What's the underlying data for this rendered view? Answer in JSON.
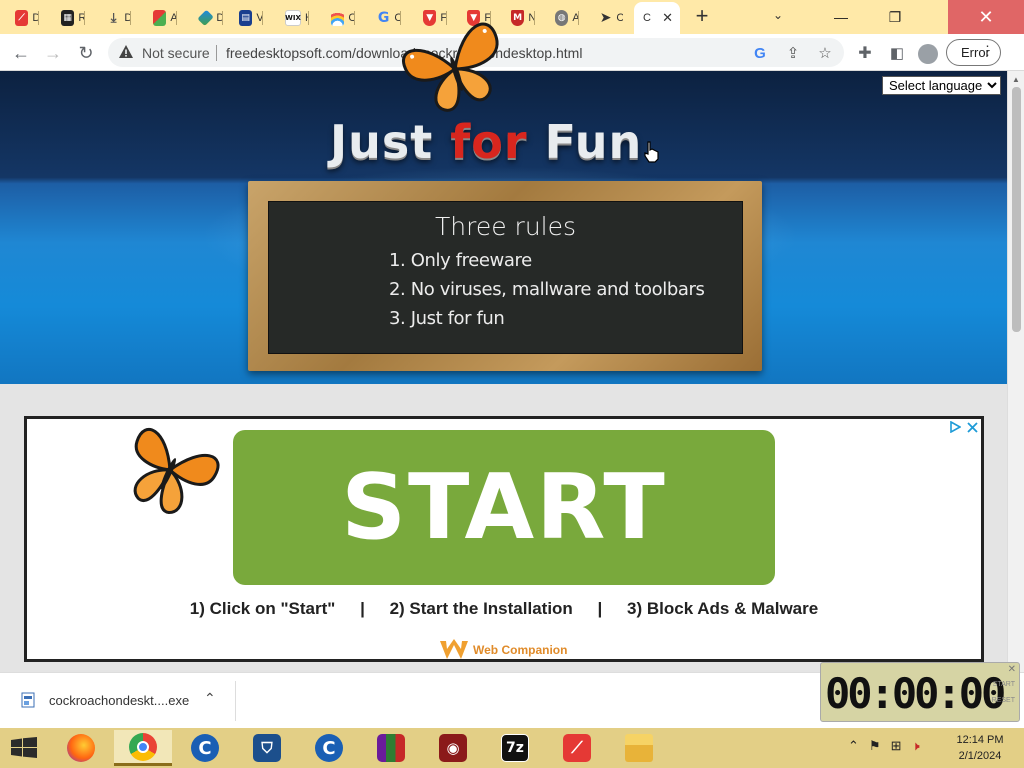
{
  "browser": {
    "tabs": [
      {
        "title": "D",
        "icon": "avira-icon",
        "color": "#e53935"
      },
      {
        "title": "R",
        "icon": "qr-icon",
        "color": "#222222"
      },
      {
        "title": "D",
        "icon": "download-icon",
        "color": "#555555"
      },
      {
        "title": "A",
        "icon": "windows-tiles-icon",
        "color": "#4caf50"
      },
      {
        "title": "D",
        "icon": "diamond-icon",
        "color": "#1e88e5"
      },
      {
        "title": "V",
        "icon": "window-icon",
        "color": "#1a3f8f"
      },
      {
        "title": "H",
        "icon": "wix-icon",
        "color": "#111111"
      },
      {
        "title": "C",
        "icon": "rainbow-icon",
        "color": "#e57373"
      },
      {
        "title": "C",
        "icon": "google-icon",
        "color": "#4285f4"
      },
      {
        "title": "F",
        "icon": "brave-shield-icon",
        "color": "#e53935"
      },
      {
        "title": "F",
        "icon": "brave-shield-icon",
        "color": "#e53935"
      },
      {
        "title": "N",
        "icon": "mcafee-icon",
        "color": "#c62828"
      },
      {
        "title": "A",
        "icon": "globe-icon",
        "color": "#777777"
      },
      {
        "title": "C",
        "icon": "cursor-icon",
        "color": "#333333"
      },
      {
        "title": "C",
        "icon": "page-icon",
        "color": "#888888",
        "active": true
      }
    ],
    "url_security": "Not secure",
    "url": "freedesktopsoft.com/download_cockroachondesktop.html",
    "error_label": "Error"
  },
  "page": {
    "title_parts": [
      "Just ",
      "for",
      " Fun"
    ],
    "language_select": {
      "selected": "Select language"
    },
    "chalkboard": {
      "title": "Three rules",
      "rules": [
        "1. Only freeware",
        "2. No viruses, mallware and toolbars",
        "3. Just for fun"
      ]
    },
    "ad": {
      "button": "START",
      "steps": [
        "1) Click on \"Start\"",
        "|",
        "2) Start the Installation",
        "|",
        "3) Block Ads & Malware"
      ],
      "brand": "Web Companion"
    }
  },
  "downloads": {
    "file": "cockroachondeskt....exe"
  },
  "timer": {
    "display": "00:00:00",
    "label_start": "START",
    "label_reset": "RESET"
  },
  "taskbar": {
    "apps": [
      "firefox-icon",
      "chrome-icon",
      "ccleaner-icon",
      "defender-icon",
      "ccleaner-icon",
      "winrar-icon",
      "screen-recorder-icon",
      "7zip-icon",
      "avira-icon",
      "file-explorer-icon"
    ],
    "seven_zip_label": "7z",
    "time": "12:14 PM",
    "date": "2/1/2024"
  }
}
